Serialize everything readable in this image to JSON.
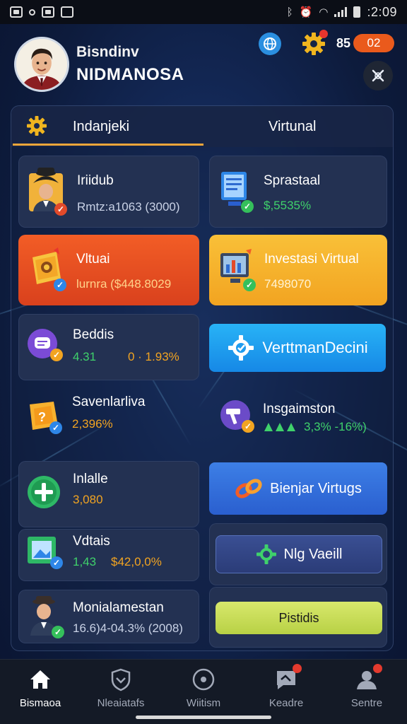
{
  "status_bar": {
    "time": ":2:09"
  },
  "header": {
    "subtitle": "Bisndinv",
    "name": "NIDMANOSA",
    "coin_count": "85",
    "coin_pill": "02"
  },
  "tabs": [
    {
      "label": "Indanjeki",
      "active": true
    },
    {
      "label": "Virtunal",
      "active": false
    }
  ],
  "cards": {
    "c1": {
      "title": "Iriidub",
      "value": "Rmtz:a1063 (3000)"
    },
    "c2": {
      "title": "Sprastaal",
      "value": "$,5535%"
    },
    "c3": {
      "title": "Vltuai",
      "value": "lurnra ($448.8029"
    },
    "c4": {
      "title": "Investasi Virtual",
      "value": "7498070"
    },
    "c5": {
      "title": "Beddis",
      "value_green": "4.31",
      "value_orange": "0 · 1.93%"
    },
    "c6": {
      "label": "VerttmanDecini"
    },
    "c7": {
      "title": "Savenlarliva",
      "value": "2,396%"
    },
    "c8": {
      "title": "Insgaimston",
      "value": "3,3% -16%)"
    },
    "c9": {
      "title": "Inlalle",
      "value": "3,080"
    },
    "c10": {
      "label": "Bienjar Virtugs"
    },
    "c11": {
      "title": "Vdtais",
      "value_green": "1,43",
      "value_orange": "$42,0,0%"
    },
    "c12": {
      "label": "Nlg Vaeill"
    },
    "c13": {
      "title": "Monialamestan",
      "value": "16.6)4-04.3% (2008)"
    },
    "c14": {
      "label": "Pistidis"
    }
  },
  "bottom_nav": [
    {
      "label": "Bismaoa",
      "icon": "home-icon",
      "active": true
    },
    {
      "label": "Nleaiatafs",
      "icon": "heart-shield-icon",
      "active": false
    },
    {
      "label": "Wiitism",
      "icon": "target-icon",
      "active": false
    },
    {
      "label": "Keadre",
      "icon": "chat-icon",
      "active": false
    },
    {
      "label": "Sentre",
      "icon": "profile-icon",
      "active": false
    }
  ],
  "colors": {
    "accent_orange": "#f25d26",
    "accent_gold": "#f9c038",
    "accent_cyan": "#28b3f6",
    "positive_green": "#3fd16b",
    "value_orange": "#f2a421"
  }
}
